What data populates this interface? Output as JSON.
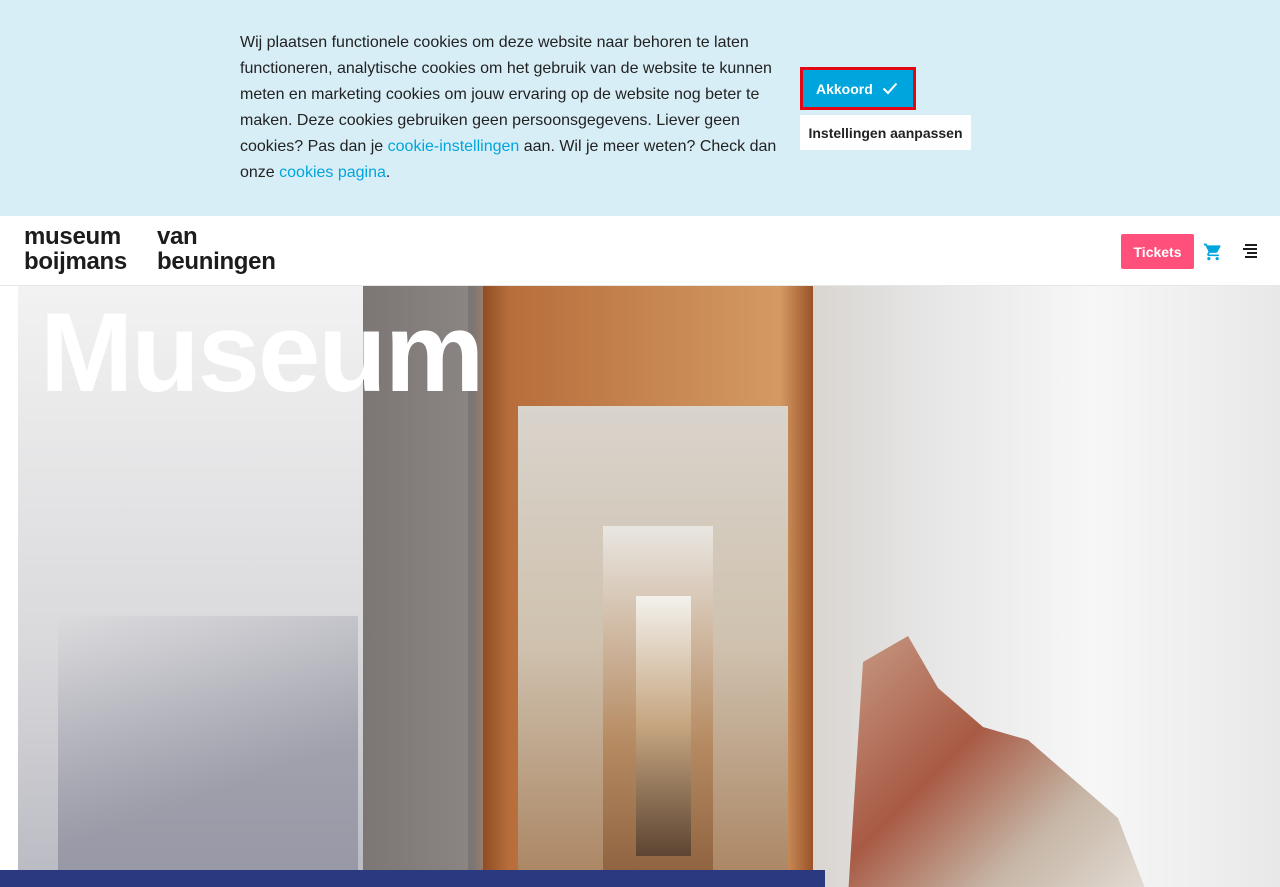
{
  "cookie_banner": {
    "text_part1": "Wij plaatsen functionele cookies om deze website naar behoren te laten functioneren, analytische cookies om het gebruik van de website te kunnen meten en marketing cookies om jouw ervaring op de website nog beter te maken. Deze cookies gebruiken geen persoonsgegevens. Liever geen cookies? Pas dan je ",
    "link1": "cookie-instellingen",
    "text_part2": " aan. Wil je meer weten? Check dan onze ",
    "link2": "cookies pagina",
    "text_part3": ".",
    "accept_label": "Akkoord",
    "settings_label": "Instellingen aanpassen",
    "colors": {
      "background": "#d8eef7",
      "accent": "#00a5dd",
      "highlight": "#e30613"
    }
  },
  "header": {
    "logo_line1a": "museum",
    "logo_line1b": "boijmans",
    "logo_line2a": "van",
    "logo_line2b": "beuningen",
    "tickets_label": "Tickets",
    "cart_icon": "cart-icon",
    "menu_icon": "menu-icon",
    "colors": {
      "tickets": "#ff4f7b",
      "cart": "#00a5dd"
    }
  },
  "hero": {
    "title": "Museum"
  }
}
